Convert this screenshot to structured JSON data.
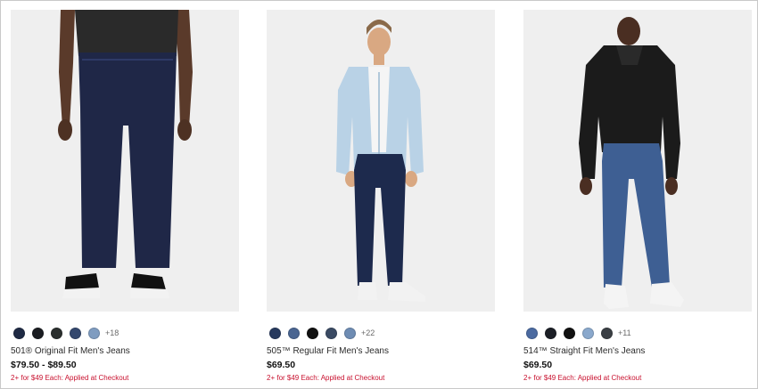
{
  "products": [
    {
      "swatches": [
        "#1f2a44",
        "#1b1d22",
        "#2b2f2e",
        "#34486e",
        "#7f9cc0"
      ],
      "more_colors": "+18",
      "name": "501® Original Fit Men's Jeans",
      "price": "$79.50 - $89.50",
      "promo": "2+ for $49 Each: Applied at Checkout"
    },
    {
      "swatches": [
        "#273a5e",
        "#4a6591",
        "#111111",
        "#3a4a63",
        "#6e8cb3"
      ],
      "more_colors": "+22",
      "name": "505™ Regular Fit Men's Jeans",
      "price": "$69.50",
      "promo": "2+ for $49 Each: Applied at Checkout"
    },
    {
      "swatches": [
        "#4b6aa0",
        "#1c1f26",
        "#111111",
        "#8aa8cc",
        "#3a3f44"
      ],
      "more_colors": "+11",
      "name": "514™ Straight Fit Men's Jeans",
      "price": "$69.50",
      "promo": "2+ for $49 Each: Applied at Checkout"
    }
  ]
}
